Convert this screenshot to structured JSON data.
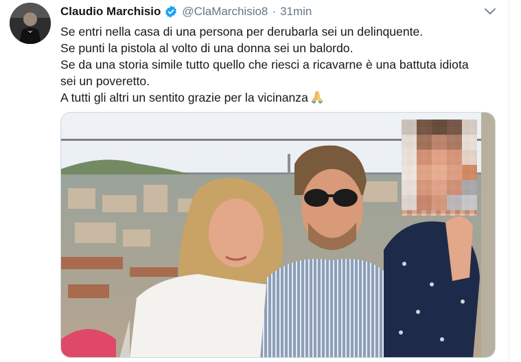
{
  "tweet": {
    "author_name": "Claudio Marchisio",
    "handle": "@ClaMarchisio8",
    "separator": "·",
    "time": "31min",
    "lines": [
      "Se entri nella casa di una persona per derubarla sei un delinquente.",
      "Se punti la pistola al volto di una donna sei un balordo.",
      "Se da una storia simile tutto quello che riesci a ricavarne è una battuta idiota",
      "sei un poveretto.",
      "A tutti gli altri un sentito grazie per la vicinanza"
    ],
    "emoji": "folded-hands",
    "verified": true
  },
  "icons": {
    "verified": "verified-badge-icon",
    "menu": "chevron-down-icon"
  },
  "colors": {
    "text": "#14171a",
    "secondary": "#657786",
    "verified_blue": "#1da1f2",
    "border": "#ccd6dd"
  }
}
